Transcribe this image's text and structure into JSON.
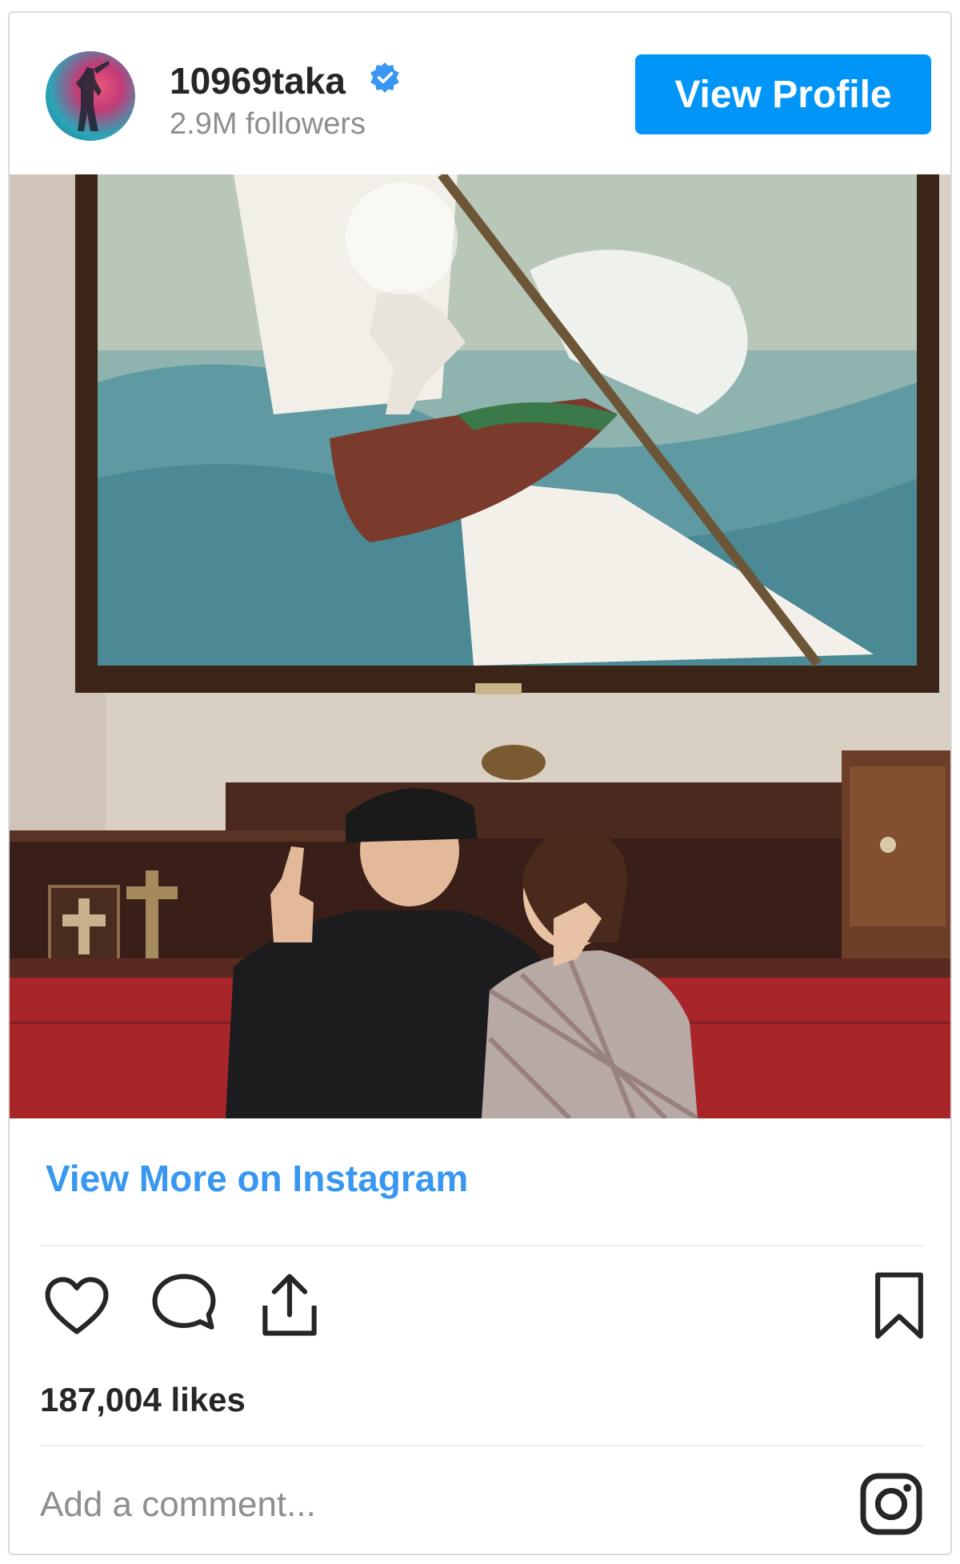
{
  "profile": {
    "username": "10969taka",
    "followers": "2.9M followers",
    "verified": true,
    "view_profile_label": "View Profile"
  },
  "post": {
    "image_alt": "Photo of two people seated on a red bench beneath a large painting of a sailboat on waves",
    "view_more_label": "View More on Instagram",
    "likes": "187,004 likes"
  },
  "comment": {
    "placeholder": "Add a comment..."
  },
  "icons": {
    "like": "heart-icon",
    "comment": "comment-icon",
    "share": "share-icon",
    "save": "bookmark-icon",
    "verified": "verified-badge-icon",
    "brand": "instagram-icon"
  },
  "colors": {
    "accent": "#0095f6",
    "link": "#3897f0",
    "text": "#262626",
    "muted": "#8e8e8e"
  }
}
